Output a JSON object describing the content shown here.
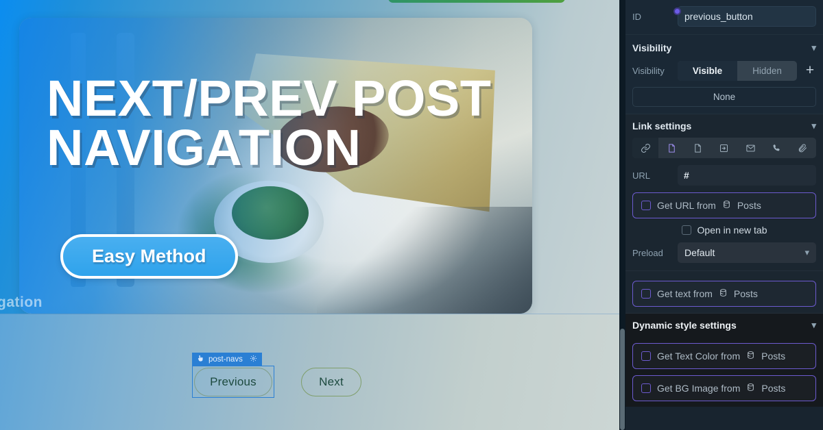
{
  "canvas": {
    "hero": {
      "title": "NEXT/PREV POST\nNAVIGATION",
      "badge_label": "Easy Method",
      "ghost_word": "gation"
    },
    "widget": {
      "selected_label": "post-navs",
      "gear_icon": "gear-icon",
      "pointer_icon": "pointer-icon",
      "previous_label": "Previous",
      "next_label": "Next"
    },
    "colors": {
      "overlay_blue": "#0a82eb",
      "badge_blue": "#2fa3ec",
      "selection_blue": "#2a7fd4",
      "next_border": "#7f9e6a",
      "top_ribbon_green": "#3a9a55"
    }
  },
  "panel": {
    "id_row": {
      "label": "ID",
      "value": "previous_button"
    },
    "visibility": {
      "section_title": "Visibility",
      "chevron": "chevron-down-icon",
      "row_label": "Visibility",
      "options": [
        "Visible",
        "Hidden"
      ],
      "selected": "Visible",
      "add_icon": "plus-icon",
      "condition_value": "None"
    },
    "link_settings": {
      "section_title": "Link settings",
      "chevron": "chevron-down-icon",
      "type_icons": [
        "link-icon",
        "page-icon",
        "page-alt-icon",
        "sign-in-icon",
        "envelope-icon",
        "phone-icon",
        "paperclip-icon"
      ],
      "active_icon": "link-icon",
      "highlighted_icon": "page-icon",
      "url_label": "URL",
      "url_value": "#",
      "get_url_from": {
        "label": "Get URL from",
        "source": "Posts",
        "source_icon": "database-icon",
        "checked": false
      },
      "open_new_tab": {
        "label": "Open in new tab",
        "checked": false
      },
      "preload_label": "Preload",
      "preload_value": "Default",
      "preload_chevron": "chevron-down-icon"
    },
    "text_source": {
      "get_text_from": {
        "label": "Get text from",
        "source": "Posts",
        "source_icon": "database-icon",
        "checked": false
      }
    },
    "dynamic_style": {
      "section_title": "Dynamic style settings",
      "chevron": "chevron-down-icon",
      "items": [
        {
          "label": "Get Text Color from",
          "source": "Posts",
          "source_icon": "database-icon",
          "checked": false
        },
        {
          "label": "Get BG Image from",
          "source": "Posts",
          "source_icon": "database-icon",
          "checked": false
        }
      ]
    },
    "colors": {
      "accent_purple": "#6d5bd0",
      "panel_bg": "#18242f",
      "dyn_bg": "#15191d"
    }
  }
}
